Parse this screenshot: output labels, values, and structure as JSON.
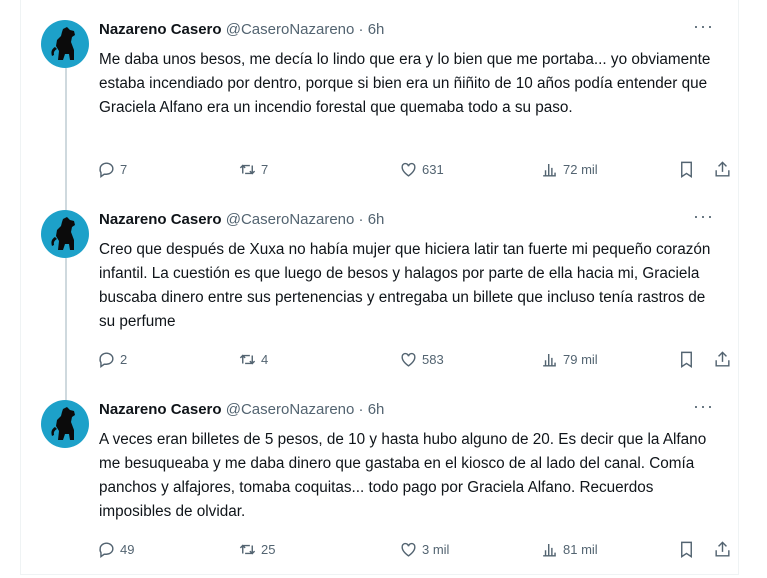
{
  "tweets": [
    {
      "name": "Nazareno Casero",
      "handle": "@CaseroNazareno",
      "time": "· 6h",
      "text": "Me daba unos besos, me decía lo lindo que era y lo bien que me portaba... yo obviamente estaba incendiado por dentro, porque si bien era un ñiñito de 10 años podía entender que Graciela Alfano era un incendio forestal que quemaba todo a su paso.",
      "replies": "7",
      "retweets": "7",
      "likes": "631",
      "views": "72 mil"
    },
    {
      "name": "Nazareno Casero",
      "handle": "@CaseroNazareno",
      "time": "· 6h",
      "text": "Creo que después de Xuxa no había mujer que hiciera latir tan fuerte mi pequeño corazón infantil. La cuestión es que luego de besos y halagos por parte de ella hacia mi, Graciela buscaba dinero entre sus pertenencias y entregaba un billete que incluso tenía rastros de su perfume",
      "replies": "2",
      "retweets": "4",
      "likes": "583",
      "views": "79 mil"
    },
    {
      "name": "Nazareno Casero",
      "handle": "@CaseroNazareno",
      "time": "· 6h",
      "text": "A veces eran billetes de 5 pesos, de 10 y hasta hubo alguno de 20. Es decir que la Alfano me besuqueaba y me daba dinero que gastaba en el kiosco de al lado del canal. Comía panchos y alfajores, tomaba coquitas... todo pago por Graciela Alfano. Recuerdos imposibles de olvidar.",
      "replies": "49",
      "retweets": "25",
      "likes": "3 mil",
      "views": "81 mil"
    }
  ],
  "icons": {
    "avatar": "dog-silhouette-icon",
    "more": "more-options-icon",
    "reply": "reply-icon",
    "retweet": "retweet-icon",
    "like": "heart-icon",
    "views": "views-icon",
    "bookmark": "bookmark-icon",
    "share": "share-icon"
  },
  "colors": {
    "avatar_bg": "#1da1c9",
    "text": "#0f1419",
    "muted": "#536471",
    "thread_line": "#cfd9de"
  }
}
